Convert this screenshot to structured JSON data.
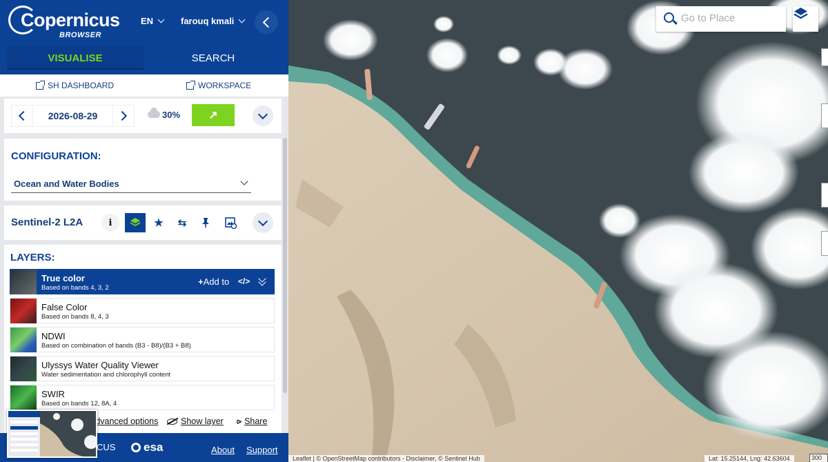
{
  "brand": {
    "name": "Copernicus",
    "subtitle": "BROWSER"
  },
  "header": {
    "language": "EN",
    "user": "farouq kmali"
  },
  "tabs": [
    {
      "label": "VISUALISE",
      "active": true
    },
    {
      "label": "SEARCH",
      "active": false
    }
  ],
  "links": {
    "dashboard": "SH DASHBOARD",
    "workspace": "WORKSPACE"
  },
  "date_picker": {
    "date": "2026-08-29",
    "cloud_cover": "30%"
  },
  "configuration": {
    "title": "CONFIGURATION:",
    "selected": "Ocean and Water Bodies"
  },
  "dataset": {
    "name": "Sentinel-2 L2A",
    "info_label": "i"
  },
  "layers": {
    "title": "LAYERS:",
    "items": [
      {
        "name": "True color",
        "description": "Based on bands 4, 3, 2",
        "active": true
      },
      {
        "name": "False Color",
        "description": "Based on bands 8, 4, 3",
        "active": false
      },
      {
        "name": "NDWI",
        "description": "Based on combination of bands (B3 - B8)/(B3 + B8)",
        "active": false
      },
      {
        "name": "Ulyssys Water Quality Viewer",
        "description": "Water sedimentation and chlorophyll content",
        "active": false
      },
      {
        "name": "SWIR",
        "description": "Based on bands 12, 8A, 4",
        "active": false
      }
    ],
    "add_to_label": "Add to",
    "code_label": "</>"
  },
  "actions": {
    "advanced": "Advanced options",
    "show_layer": "Show layer",
    "share": "Share"
  },
  "footer": {
    "logo_fragment": "CUS",
    "esa": "esa",
    "about": "About",
    "support": "Support"
  },
  "map": {
    "search_placeholder": "Go to Place",
    "attribution": "Leaflet | © OpenStreetMap contributors - Disclaimer, © Sentinel Hub",
    "coordinates": "Lat: 15.25144, Lng: 42.63604",
    "scale": "300"
  },
  "colors": {
    "primary": "#0b4296",
    "accent": "#7ed321",
    "sand": "#d8c8b0",
    "sea": "#3e4a4f"
  }
}
